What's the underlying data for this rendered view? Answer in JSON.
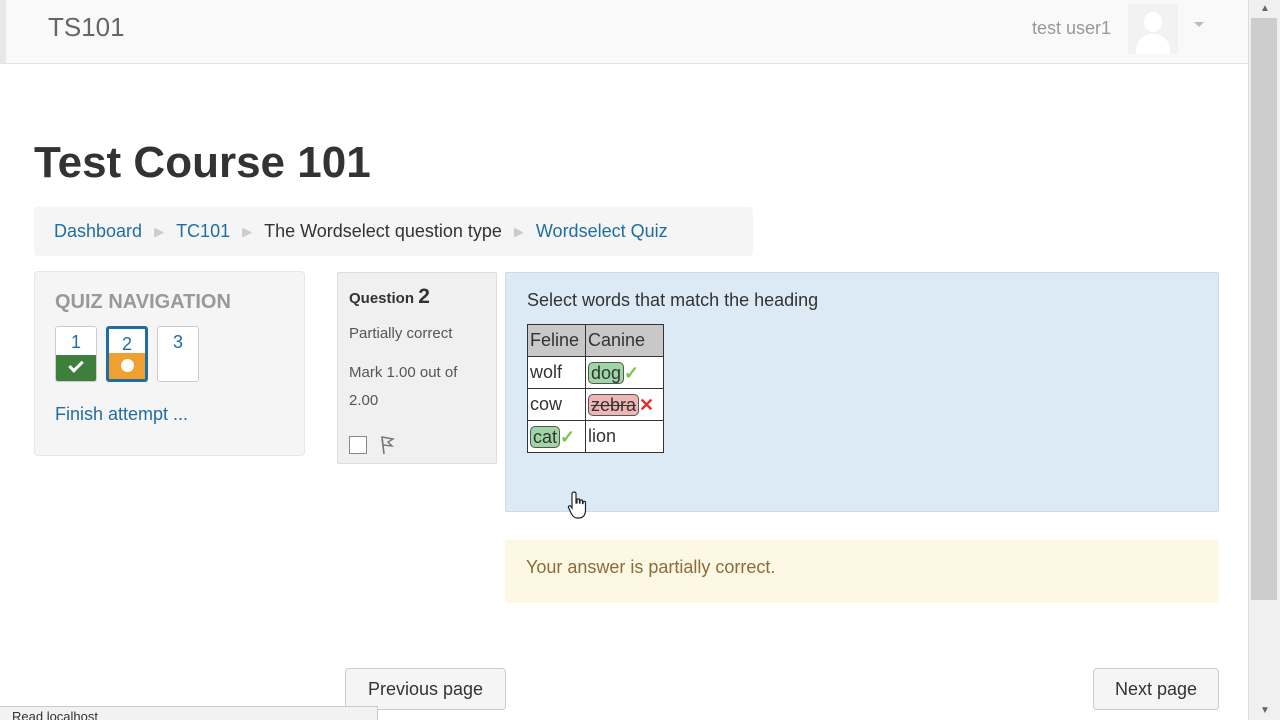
{
  "navbar": {
    "brand": "TS101",
    "user_name": "test user1"
  },
  "page": {
    "title": "Test Course 101"
  },
  "breadcrumb": [
    {
      "label": "Dashboard",
      "link": true
    },
    {
      "label": "TC101",
      "link": true
    },
    {
      "label": "The Wordselect question type",
      "link": false
    },
    {
      "label": "Wordselect Quiz",
      "link": true
    }
  ],
  "quiz_nav": {
    "title": "QUIZ NAVIGATION",
    "questions": [
      {
        "number": "1",
        "state": "correct"
      },
      {
        "number": "2",
        "state": "partially correct"
      },
      {
        "number": "3",
        "state": "not answered"
      }
    ],
    "finish_link": "Finish attempt ..."
  },
  "question": {
    "label": "Question",
    "number": "2",
    "state": "Partially correct",
    "grade": "Mark 1.00 out of 2.00",
    "text": "Select words that match the heading",
    "table": {
      "headers": [
        "Feline",
        "Canine"
      ],
      "rows": [
        [
          "wolf",
          "dog"
        ],
        [
          "cow",
          "zebra"
        ],
        [
          "cat",
          "lion"
        ]
      ]
    },
    "feedback": "Your answer is partially correct."
  },
  "buttons": {
    "previous": "Previous page",
    "next": "Next page"
  },
  "status_bar": "Read localhost",
  "colors": {
    "link": "#1f6ea3",
    "correct": "#3e7f3e",
    "partial": "#f0a030",
    "content_bg": "#dbeaf5",
    "feedback_bg": "#fcf8e3"
  }
}
